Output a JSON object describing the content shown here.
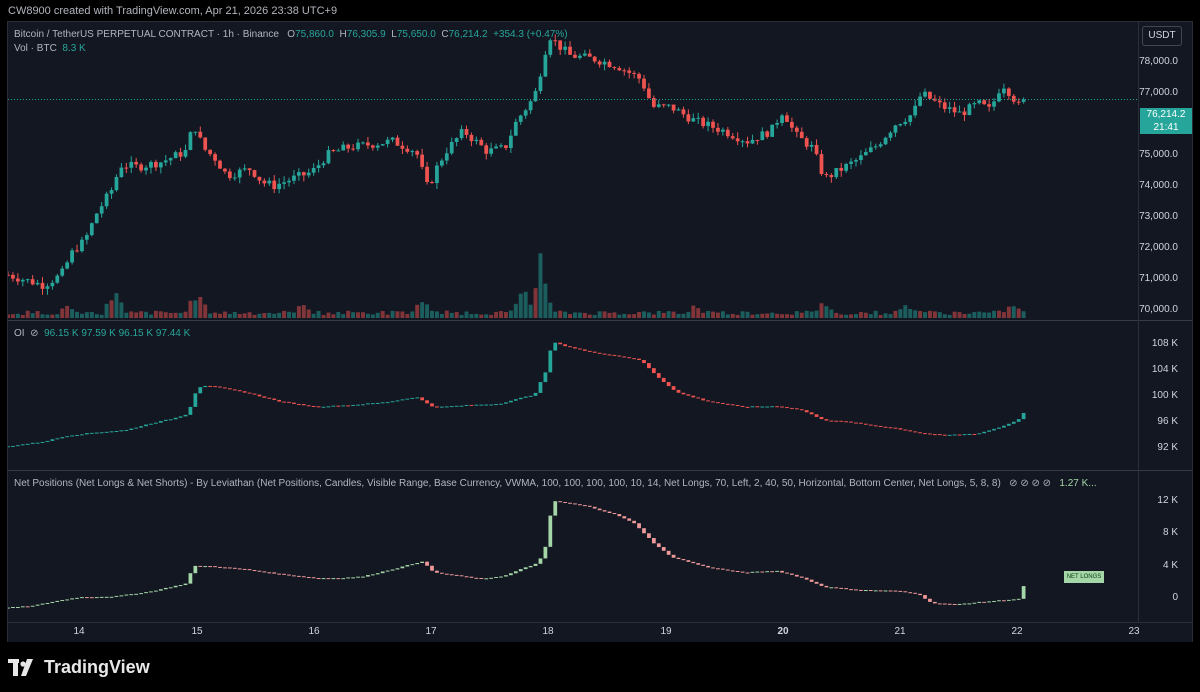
{
  "credit": "CW8900 created with TradingView.com, Apr 21, 2026 23:38 UTC+9",
  "brand": {
    "logo_text": "TradingView",
    "logo_icon": "tradingview-logo-icon"
  },
  "price_legend": {
    "symbol": "Bitcoin / TetherUS PERPETUAL CONTRACT · 1h · Binance",
    "o_label": "O",
    "o_value": "75,860.0",
    "h_label": "H",
    "h_value": "76,305.9",
    "l_label": "L",
    "l_value": "75,650.0",
    "c_label": "C",
    "c_value": "76,214.2",
    "change": "+354.3 (+0.47%)",
    "vol_label": "Vol · BTC",
    "vol_value": "8.3 K"
  },
  "oi_legend": {
    "label": "OI",
    "icon": "hidden-eye-slash-icon",
    "values": "96.15 K  97.59 K  96.15 K  97.44 K"
  },
  "np_legend": {
    "label": "Net Positions (Net Longs & Net Shorts) - By Leviathan (Net Positions, Candles, Visible Range, Base Currency, VWMA, 100, 100, 100, 100, 10, 14, Net Longs, 70, Left, 2, 40, 50, Horizontal, Bottom Center, Net Longs, 5, 8, 8)",
    "icons": "⊘ ⊘ ⊘ ⊘",
    "value": "1.27 K..."
  },
  "price_axis": {
    "unit": "USDT",
    "ticks": [
      "78,000.0",
      "77,000.0",
      "75,000.0",
      "74,000.0",
      "73,000.0",
      "72,000.0",
      "71,000.0",
      "70,000.0"
    ]
  },
  "price_tag": {
    "price": "76,214.2",
    "countdown": "21:41"
  },
  "oi_axis": {
    "ticks": [
      "108 K",
      "104 K",
      "100 K",
      "96 K",
      "92 K"
    ]
  },
  "np_axis": {
    "ticks": [
      "12 K",
      "8 K",
      "4 K",
      "0"
    ]
  },
  "np_tag": "NET LONGS",
  "time_axis": {
    "ticks": [
      "14",
      "15",
      "16",
      "17",
      "18",
      "19",
      "20",
      "21",
      "22",
      "23"
    ]
  },
  "colors": {
    "up": "#26a69a",
    "down": "#ef5350",
    "background": "#131722",
    "np_up": "#a5d6a7",
    "np_down": "#ef9a9a"
  },
  "chart_data": [
    {
      "type": "candlestick",
      "title": "Bitcoin / TetherUS PERPETUAL CONTRACT · 1h · Binance",
      "ylabel": "USDT",
      "ylim": [
        69900,
        78300
      ],
      "x_range_days": [
        13.4,
        22.95
      ],
      "grid": false,
      "last_price": 76214.2,
      "close_path": [
        [
          13.4,
          71100
        ],
        [
          13.55,
          70950
        ],
        [
          13.7,
          70800
        ],
        [
          13.85,
          71100
        ],
        [
          13.95,
          71800
        ],
        [
          14.05,
          72100
        ],
        [
          14.15,
          72900
        ],
        [
          14.28,
          73600
        ],
        [
          14.35,
          74300
        ],
        [
          14.5,
          74250
        ],
        [
          14.7,
          74400
        ],
        [
          14.9,
          74700
        ],
        [
          14.97,
          75500
        ],
        [
          15.05,
          74800
        ],
        [
          15.15,
          74500
        ],
        [
          15.25,
          74000
        ],
        [
          15.45,
          74200
        ],
        [
          15.55,
          73800
        ],
        [
          15.65,
          73700
        ],
        [
          15.8,
          73900
        ],
        [
          15.97,
          74100
        ],
        [
          16.1,
          74600
        ],
        [
          16.25,
          74800
        ],
        [
          16.45,
          74900
        ],
        [
          16.65,
          75000
        ],
        [
          16.85,
          74700
        ],
        [
          16.95,
          73600
        ],
        [
          17.02,
          74200
        ],
        [
          17.1,
          74700
        ],
        [
          17.25,
          75300
        ],
        [
          17.45,
          74700
        ],
        [
          17.6,
          74800
        ],
        [
          17.7,
          75600
        ],
        [
          17.85,
          76300
        ],
        [
          17.92,
          77300
        ],
        [
          17.97,
          78100
        ],
        [
          18.05,
          77800
        ],
        [
          18.15,
          77500
        ],
        [
          18.35,
          77400
        ],
        [
          18.55,
          77200
        ],
        [
          18.75,
          76800
        ],
        [
          18.85,
          76000
        ],
        [
          19.0,
          76000
        ],
        [
          19.2,
          75600
        ],
        [
          19.45,
          75300
        ],
        [
          19.65,
          75000
        ],
        [
          19.85,
          75300
        ],
        [
          19.95,
          75900
        ],
        [
          20.05,
          75200
        ],
        [
          20.2,
          74800
        ],
        [
          20.3,
          73900
        ],
        [
          20.45,
          74200
        ],
        [
          20.6,
          74500
        ],
        [
          20.75,
          74900
        ],
        [
          20.9,
          75500
        ],
        [
          21.05,
          75800
        ],
        [
          21.12,
          76400
        ],
        [
          21.3,
          76000
        ],
        [
          21.45,
          75800
        ],
        [
          21.6,
          76100
        ],
        [
          21.7,
          75900
        ],
        [
          21.8,
          76700
        ],
        [
          21.87,
          76400
        ],
        [
          21.95,
          76000
        ],
        [
          22.0,
          76214
        ]
      ]
    },
    {
      "type": "bar",
      "title": "Vol · BTC",
      "note": "volume histogram under price panel, relative heights",
      "last_value": "8.3 K",
      "relative_peaks": [
        [
          13.9,
          0.2
        ],
        [
          14.3,
          0.45
        ],
        [
          15.0,
          0.45
        ],
        [
          15.9,
          0.25
        ],
        [
          16.9,
          0.3
        ],
        [
          17.75,
          0.45
        ],
        [
          17.9,
          0.95
        ],
        [
          19.2,
          0.2
        ],
        [
          20.3,
          0.25
        ],
        [
          21.0,
          0.25
        ],
        [
          21.9,
          0.25
        ]
      ]
    },
    {
      "type": "candlestick",
      "title": "OI",
      "ylim": [
        89000,
        110000
      ],
      "last_value": 97440,
      "path": [
        [
          13.4,
          91700
        ],
        [
          13.7,
          92500
        ],
        [
          13.9,
          93500
        ],
        [
          14.1,
          94000
        ],
        [
          14.4,
          94500
        ],
        [
          14.6,
          95600
        ],
        [
          14.8,
          96500
        ],
        [
          14.92,
          97300
        ],
        [
          15.0,
          101800
        ],
        [
          15.08,
          102200
        ],
        [
          15.4,
          101000
        ],
        [
          15.7,
          99400
        ],
        [
          16.0,
          98500
        ],
        [
          16.3,
          98800
        ],
        [
          16.6,
          99300
        ],
        [
          16.85,
          100200
        ],
        [
          17.0,
          98400
        ],
        [
          17.3,
          98800
        ],
        [
          17.55,
          99000
        ],
        [
          17.75,
          100100
        ],
        [
          17.85,
          100600
        ],
        [
          17.95,
          104800
        ],
        [
          18.0,
          109800
        ],
        [
          18.05,
          109300
        ],
        [
          18.3,
          108000
        ],
        [
          18.6,
          107100
        ],
        [
          18.75,
          106500
        ],
        [
          18.9,
          103500
        ],
        [
          19.05,
          101000
        ],
        [
          19.3,
          99500
        ],
        [
          19.6,
          98500
        ],
        [
          19.9,
          98600
        ],
        [
          20.1,
          98000
        ],
        [
          20.3,
          96200
        ],
        [
          20.5,
          95900
        ],
        [
          20.7,
          95300
        ],
        [
          20.9,
          94800
        ],
        [
          21.1,
          94000
        ],
        [
          21.3,
          93600
        ],
        [
          21.6,
          93900
        ],
        [
          21.8,
          95100
        ],
        [
          21.95,
          96400
        ],
        [
          22.0,
          97440
        ]
      ]
    },
    {
      "type": "candlestick",
      "title": "Net Positions (Net Longs & Net Shorts)",
      "ylim": [
        -800,
        14000
      ],
      "last_value": 1270,
      "path": [
        [
          13.4,
          0
        ],
        [
          13.6,
          200
        ],
        [
          13.8,
          800
        ],
        [
          14.0,
          1300
        ],
        [
          14.3,
          1400
        ],
        [
          14.6,
          2000
        ],
        [
          14.9,
          3000
        ],
        [
          14.97,
          5200
        ],
        [
          15.1,
          5200
        ],
        [
          15.4,
          4800
        ],
        [
          15.7,
          4200
        ],
        [
          16.0,
          3700
        ],
        [
          16.2,
          3700
        ],
        [
          16.4,
          3900
        ],
        [
          16.7,
          5000
        ],
        [
          16.9,
          5800
        ],
        [
          17.0,
          4400
        ],
        [
          17.2,
          4000
        ],
        [
          17.4,
          3600
        ],
        [
          17.6,
          4000
        ],
        [
          17.75,
          4900
        ],
        [
          17.85,
          5400
        ],
        [
          17.93,
          6600
        ],
        [
          17.97,
          10000
        ],
        [
          18.0,
          13400
        ],
        [
          18.3,
          12700
        ],
        [
          18.55,
          11600
        ],
        [
          18.7,
          10500
        ],
        [
          18.85,
          8200
        ],
        [
          19.0,
          6400
        ],
        [
          19.3,
          5100
        ],
        [
          19.6,
          4400
        ],
        [
          19.9,
          4600
        ],
        [
          20.1,
          3800
        ],
        [
          20.3,
          2600
        ],
        [
          20.6,
          2200
        ],
        [
          20.9,
          2100
        ],
        [
          21.1,
          1700
        ],
        [
          21.2,
          600
        ],
        [
          21.4,
          400
        ],
        [
          21.7,
          800
        ],
        [
          21.95,
          1100
        ],
        [
          22.0,
          2700
        ]
      ]
    }
  ]
}
